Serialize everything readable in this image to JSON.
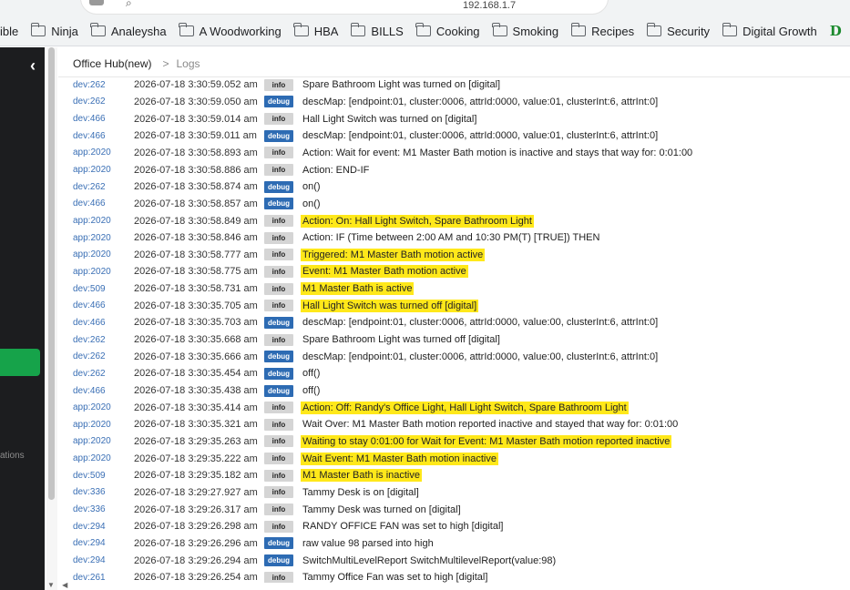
{
  "browser": {
    "url_text": "192.168.1.7"
  },
  "bookmarks": [
    {
      "label": "ible",
      "type": "text"
    },
    {
      "label": "Ninja",
      "type": "folder"
    },
    {
      "label": "Analeysha",
      "type": "folder"
    },
    {
      "label": "A Woodworking",
      "type": "folder"
    },
    {
      "label": "HBA",
      "type": "folder"
    },
    {
      "label": "BILLS",
      "type": "folder"
    },
    {
      "label": "Cooking",
      "type": "folder"
    },
    {
      "label": "Smoking",
      "type": "folder"
    },
    {
      "label": "Recipes",
      "type": "folder"
    },
    {
      "label": "Security",
      "type": "folder"
    },
    {
      "label": "Digital Growth",
      "type": "folder"
    },
    {
      "label": "Dan-O's Seas",
      "type": "logo"
    }
  ],
  "sidebar": {
    "collapse_icon": "‹",
    "faded_label": "ations"
  },
  "breadcrumb": {
    "hub": "Office Hub(new)",
    "separator": ">",
    "current": "Logs"
  },
  "colors": {
    "highlight": "#ffe81a",
    "debug_badge": "#2d6bb3",
    "info_badge": "#d5d5d5",
    "device_link": "#3a6fb5",
    "sidebar_active": "#16a34a"
  },
  "logs": [
    {
      "dev": "dev:262",
      "ts": "2026-07-18 3:30:59.052 am",
      "level": "info",
      "msg": "Spare Bathroom Light was turned on [digital]",
      "hl": false
    },
    {
      "dev": "dev:262",
      "ts": "2026-07-18 3:30:59.050 am",
      "level": "debug",
      "msg": "descMap: [endpoint:01, cluster:0006, attrId:0000, value:01, clusterInt:6, attrInt:0]",
      "hl": false
    },
    {
      "dev": "dev:466",
      "ts": "2026-07-18 3:30:59.014 am",
      "level": "info",
      "msg": "Hall Light Switch was turned on [digital]",
      "hl": false
    },
    {
      "dev": "dev:466",
      "ts": "2026-07-18 3:30:59.011 am",
      "level": "debug",
      "msg": "descMap: [endpoint:01, cluster:0006, attrId:0000, value:01, clusterInt:6, attrInt:0]",
      "hl": false
    },
    {
      "dev": "app:2020",
      "ts": "2026-07-18 3:30:58.893 am",
      "level": "info",
      "msg": "Action: Wait for event: M1 Master Bath motion is inactive and stays that way for: 0:01:00",
      "hl": false
    },
    {
      "dev": "app:2020",
      "ts": "2026-07-18 3:30:58.886 am",
      "level": "info",
      "msg": "Action: END-IF",
      "hl": false
    },
    {
      "dev": "dev:262",
      "ts": "2026-07-18 3:30:58.874 am",
      "level": "debug",
      "msg": "on()",
      "hl": false
    },
    {
      "dev": "dev:466",
      "ts": "2026-07-18 3:30:58.857 am",
      "level": "debug",
      "msg": "on()",
      "hl": false
    },
    {
      "dev": "app:2020",
      "ts": "2026-07-18 3:30:58.849 am",
      "level": "info",
      "msg": "Action: On: Hall Light Switch, Spare Bathroom Light",
      "hl": true
    },
    {
      "dev": "app:2020",
      "ts": "2026-07-18 3:30:58.846 am",
      "level": "info",
      "msg": "Action: IF (Time between 2:00 AM and 10:30 PM(T) [TRUE]) THEN",
      "hl": false
    },
    {
      "dev": "app:2020",
      "ts": "2026-07-18 3:30:58.777 am",
      "level": "info",
      "msg": "Triggered: M1 Master Bath motion active",
      "hl": true
    },
    {
      "dev": "app:2020",
      "ts": "2026-07-18 3:30:58.775 am",
      "level": "info",
      "msg": "Event: M1 Master Bath motion active",
      "hl": true
    },
    {
      "dev": "dev:509",
      "ts": "2026-07-18 3:30:58.731 am",
      "level": "info",
      "msg": "M1 Master Bath is active",
      "hl": true
    },
    {
      "dev": "dev:466",
      "ts": "2026-07-18 3:30:35.705 am",
      "level": "info",
      "msg": "Hall Light Switch was turned off [digital]",
      "hl": true
    },
    {
      "dev": "dev:466",
      "ts": "2026-07-18 3:30:35.703 am",
      "level": "debug",
      "msg": "descMap: [endpoint:01, cluster:0006, attrId:0000, value:00, clusterInt:6, attrInt:0]",
      "hl": false
    },
    {
      "dev": "dev:262",
      "ts": "2026-07-18 3:30:35.668 am",
      "level": "info",
      "msg": "Spare Bathroom Light was turned off [digital]",
      "hl": false
    },
    {
      "dev": "dev:262",
      "ts": "2026-07-18 3:30:35.666 am",
      "level": "debug",
      "msg": "descMap: [endpoint:01, cluster:0006, attrId:0000, value:00, clusterInt:6, attrInt:0]",
      "hl": false
    },
    {
      "dev": "dev:262",
      "ts": "2026-07-18 3:30:35.454 am",
      "level": "debug",
      "msg": "off()",
      "hl": false
    },
    {
      "dev": "dev:466",
      "ts": "2026-07-18 3:30:35.438 am",
      "level": "debug",
      "msg": "off()",
      "hl": false
    },
    {
      "dev": "app:2020",
      "ts": "2026-07-18 3:30:35.414 am",
      "level": "info",
      "msg": "Action: Off: Randy's Office Light, Hall Light Switch, Spare Bathroom Light",
      "hl": true
    },
    {
      "dev": "app:2020",
      "ts": "2026-07-18 3:30:35.321 am",
      "level": "info",
      "msg": "Wait Over: M1 Master Bath motion reported inactive and stayed that way for: 0:01:00",
      "hl": false
    },
    {
      "dev": "app:2020",
      "ts": "2026-07-18 3:29:35.263 am",
      "level": "info",
      "msg": "Waiting to stay 0:01:00 for Wait for Event: M1 Master Bath motion reported inactive",
      "hl": true
    },
    {
      "dev": "app:2020",
      "ts": "2026-07-18 3:29:35.222 am",
      "level": "info",
      "msg": "Wait Event: M1 Master Bath motion inactive",
      "hl": true
    },
    {
      "dev": "dev:509",
      "ts": "2026-07-18 3:29:35.182 am",
      "level": "info",
      "msg": "M1 Master Bath is inactive",
      "hl": true
    },
    {
      "dev": "dev:336",
      "ts": "2026-07-18 3:29:27.927 am",
      "level": "info",
      "msg": "Tammy Desk is on [digital]",
      "hl": false
    },
    {
      "dev": "dev:336",
      "ts": "2026-07-18 3:29:26.317 am",
      "level": "info",
      "msg": "Tammy Desk was turned on [digital]",
      "hl": false
    },
    {
      "dev": "dev:294",
      "ts": "2026-07-18 3:29:26.298 am",
      "level": "info",
      "msg": "RANDY OFFICE FAN was set to high [digital]",
      "hl": false
    },
    {
      "dev": "dev:294",
      "ts": "2026-07-18 3:29:26.296 am",
      "level": "debug",
      "msg": "raw value 98 parsed into high",
      "hl": false
    },
    {
      "dev": "dev:294",
      "ts": "2026-07-18 3:29:26.294 am",
      "level": "debug",
      "msg": "SwitchMultiLevelReport SwitchMultilevelReport(value:98)",
      "hl": false
    },
    {
      "dev": "dev:261",
      "ts": "2026-07-18 3:29:26.254 am",
      "level": "info",
      "msg": "Tammy Office Fan was set to high [digital]",
      "hl": false
    }
  ]
}
